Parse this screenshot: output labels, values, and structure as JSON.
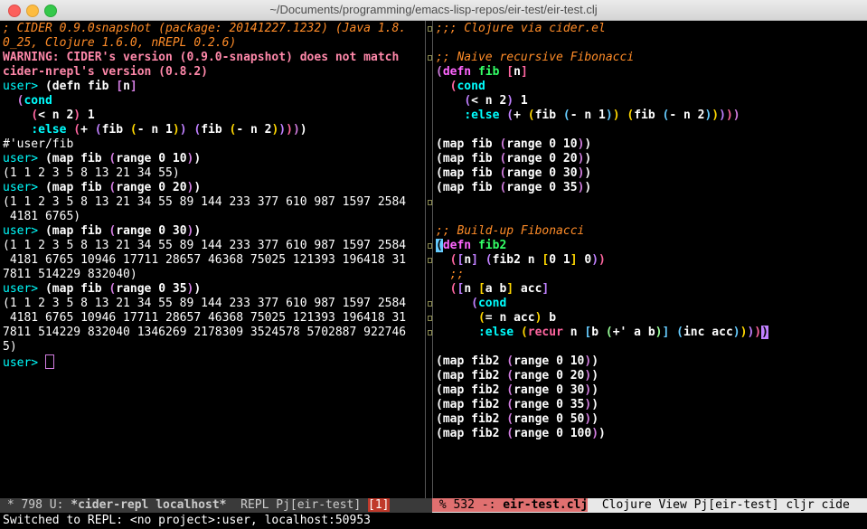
{
  "window": {
    "title": "~/Documents/programming/emacs-lisp-repos/eir-test/eir-test.clj"
  },
  "colors": {
    "comment": "#ff8c28",
    "warning": "#ff88aa",
    "prompt": "#00ffff",
    "paren1": "#ffffff",
    "paren2": "#d27de0",
    "paren3": "#ff66a0",
    "paren4": "#c080ff",
    "keyword": "#00ffff",
    "defn": "#ff66ff",
    "fnname": "#33ff66",
    "special": "#ff66a0",
    "number": "#ffffff",
    "cursor": "#d27de0"
  },
  "left_lines": [
    [
      {
        "t": "; CIDER 0.9.0snapshot (package: 20141227.1232) (Java 1.8.",
        "c": "comment"
      }
    ],
    [
      {
        "t": "0_25, Clojure 1.6.0, nREPL 0.2.6)",
        "c": "comment"
      }
    ],
    [
      {
        "t": "WARNING: CIDER's version (0.9.0-snapshot) does not match",
        "c": "warning"
      }
    ],
    [
      {
        "t": "cider-nrepl's version (0.8.2)",
        "c": "warning"
      }
    ],
    [
      {
        "t": "user> ",
        "c": "prompt"
      },
      {
        "t": "(",
        "c": "p1"
      },
      {
        "t": "defn fib ",
        "c": "code"
      },
      {
        "t": "[",
        "c": "p2"
      },
      {
        "t": "n",
        "c": "code"
      },
      {
        "t": "]",
        "c": "p2"
      }
    ],
    [
      {
        "t": "  ",
        "c": "code"
      },
      {
        "t": "(",
        "c": "p2"
      },
      {
        "t": "cond",
        "c": "kw2"
      }
    ],
    [
      {
        "t": "    ",
        "c": "code"
      },
      {
        "t": "(",
        "c": "p3"
      },
      {
        "t": "< n 2",
        "c": "code"
      },
      {
        "t": ")",
        "c": "p3"
      },
      {
        "t": " 1",
        "c": "code"
      }
    ],
    [
      {
        "t": "    ",
        "c": "code"
      },
      {
        "t": ":else",
        "c": "kw"
      },
      {
        "t": " ",
        "c": "code"
      },
      {
        "t": "(",
        "c": "p3"
      },
      {
        "t": "+ ",
        "c": "code"
      },
      {
        "t": "(",
        "c": "p4"
      },
      {
        "t": "fib ",
        "c": "code"
      },
      {
        "t": "(",
        "c": "p5"
      },
      {
        "t": "- n 1",
        "c": "code"
      },
      {
        "t": ")",
        "c": "p5"
      },
      {
        "t": ")",
        "c": "p4"
      },
      {
        "t": " ",
        "c": "code"
      },
      {
        "t": "(",
        "c": "p4"
      },
      {
        "t": "fib ",
        "c": "code"
      },
      {
        "t": "(",
        "c": "p5"
      },
      {
        "t": "- n 2",
        "c": "code"
      },
      {
        "t": ")",
        "c": "p5"
      },
      {
        "t": ")",
        "c": "p4"
      },
      {
        "t": ")",
        "c": "p3"
      },
      {
        "t": ")",
        "c": "p2"
      },
      {
        "t": ")",
        "c": "p1"
      }
    ],
    [
      {
        "t": "#'user/fib",
        "c": "out"
      }
    ],
    [
      {
        "t": "user> ",
        "c": "prompt"
      },
      {
        "t": "(map fib ",
        "c": "code"
      },
      {
        "t": "(",
        "c": "p2"
      },
      {
        "t": "range 0 10",
        "c": "code"
      },
      {
        "t": ")",
        "c": "p2"
      },
      {
        "t": ")",
        "c": "code"
      }
    ],
    [
      {
        "t": "(1 1 2 3 5 8 13 21 34 55)",
        "c": "out"
      }
    ],
    [
      {
        "t": "user> ",
        "c": "prompt"
      },
      {
        "t": "(map fib ",
        "c": "code"
      },
      {
        "t": "(",
        "c": "p2"
      },
      {
        "t": "range 0 20",
        "c": "code"
      },
      {
        "t": ")",
        "c": "p2"
      },
      {
        "t": ")",
        "c": "code"
      }
    ],
    [
      {
        "t": "(1 1 2 3 5 8 13 21 34 55 89 144 233 377 610 987 1597 2584",
        "c": "out"
      }
    ],
    [
      {
        "t": " 4181 6765)",
        "c": "out"
      }
    ],
    [
      {
        "t": "user> ",
        "c": "prompt"
      },
      {
        "t": "(map fib ",
        "c": "code"
      },
      {
        "t": "(",
        "c": "p2"
      },
      {
        "t": "range 0 30",
        "c": "code"
      },
      {
        "t": ")",
        "c": "p2"
      },
      {
        "t": ")",
        "c": "code"
      }
    ],
    [
      {
        "t": "(1 1 2 3 5 8 13 21 34 55 89 144 233 377 610 987 1597 2584",
        "c": "out"
      }
    ],
    [
      {
        "t": " 4181 6765 10946 17711 28657 46368 75025 121393 196418 31",
        "c": "out"
      }
    ],
    [
      {
        "t": "7811 514229 832040)",
        "c": "out"
      }
    ],
    [
      {
        "t": "user> ",
        "c": "prompt"
      },
      {
        "t": "(map fib ",
        "c": "code"
      },
      {
        "t": "(",
        "c": "p2"
      },
      {
        "t": "range 0 35",
        "c": "code"
      },
      {
        "t": ")",
        "c": "p2"
      },
      {
        "t": ")",
        "c": "code"
      }
    ],
    [
      {
        "t": "(1 1 2 3 5 8 13 21 34 55 89 144 233 377 610 987 1597 2584",
        "c": "out"
      }
    ],
    [
      {
        "t": " 4181 6765 10946 17711 28657 46368 75025 121393 196418 31",
        "c": "out"
      }
    ],
    [
      {
        "t": "7811 514229 832040 1346269 2178309 3524578 5702887 922746",
        "c": "out"
      }
    ],
    [
      {
        "t": "5)",
        "c": "out"
      }
    ],
    [
      {
        "t": "user> ",
        "c": "prompt"
      },
      {
        "t": "",
        "c": "cursor"
      }
    ]
  ],
  "right_lines": [
    [
      {
        "t": ";;; Clojure via cider.el",
        "c": "comment"
      }
    ],
    [
      {
        "t": "",
        "c": "out"
      }
    ],
    [
      {
        "t": ";; Naive recursive Fibonacci",
        "c": "comment"
      }
    ],
    [
      {
        "t": "(",
        "c": "p2"
      },
      {
        "t": "defn",
        "c": "defn"
      },
      {
        "t": " ",
        "c": "code"
      },
      {
        "t": "fib",
        "c": "fn"
      },
      {
        "t": " ",
        "c": "code"
      },
      {
        "t": "[",
        "c": "p3"
      },
      {
        "t": "n",
        "c": "code"
      },
      {
        "t": "]",
        "c": "p3"
      }
    ],
    [
      {
        "t": "  ",
        "c": "code"
      },
      {
        "t": "(",
        "c": "p3"
      },
      {
        "t": "cond",
        "c": "kw2"
      }
    ],
    [
      {
        "t": "    ",
        "c": "code"
      },
      {
        "t": "(",
        "c": "p4"
      },
      {
        "t": "< n 2",
        "c": "code"
      },
      {
        "t": ")",
        "c": "p4"
      },
      {
        "t": " 1",
        "c": "code"
      }
    ],
    [
      {
        "t": "    ",
        "c": "code"
      },
      {
        "t": ":else",
        "c": "kw"
      },
      {
        "t": " ",
        "c": "code"
      },
      {
        "t": "(",
        "c": "p4"
      },
      {
        "t": "+ ",
        "c": "code"
      },
      {
        "t": "(",
        "c": "p5"
      },
      {
        "t": "fib ",
        "c": "code"
      },
      {
        "t": "(",
        "c": "p6"
      },
      {
        "t": "- n 1",
        "c": "code"
      },
      {
        "t": ")",
        "c": "p6"
      },
      {
        "t": ")",
        "c": "p5"
      },
      {
        "t": " ",
        "c": "code"
      },
      {
        "t": "(",
        "c": "p5"
      },
      {
        "t": "fib ",
        "c": "code"
      },
      {
        "t": "(",
        "c": "p6"
      },
      {
        "t": "- n 2",
        "c": "code"
      },
      {
        "t": ")",
        "c": "p6"
      },
      {
        "t": ")",
        "c": "p5"
      },
      {
        "t": ")",
        "c": "p4"
      },
      {
        "t": ")",
        "c": "p3"
      },
      {
        "t": ")",
        "c": "p2"
      }
    ],
    [
      {
        "t": "",
        "c": "out"
      }
    ],
    [
      {
        "t": "(map fib ",
        "c": "code"
      },
      {
        "t": "(",
        "c": "p2"
      },
      {
        "t": "range 0 10",
        "c": "code"
      },
      {
        "t": ")",
        "c": "p2"
      },
      {
        "t": ")",
        "c": "code"
      }
    ],
    [
      {
        "t": "(map fib ",
        "c": "code"
      },
      {
        "t": "(",
        "c": "p2"
      },
      {
        "t": "range 0 20",
        "c": "code"
      },
      {
        "t": ")",
        "c": "p2"
      },
      {
        "t": ")",
        "c": "code"
      }
    ],
    [
      {
        "t": "(map fib ",
        "c": "code"
      },
      {
        "t": "(",
        "c": "p2"
      },
      {
        "t": "range 0 30",
        "c": "code"
      },
      {
        "t": ")",
        "c": "p2"
      },
      {
        "t": ")",
        "c": "code"
      }
    ],
    [
      {
        "t": "(map fib ",
        "c": "code"
      },
      {
        "t": "(",
        "c": "p2"
      },
      {
        "t": "range 0 35",
        "c": "code"
      },
      {
        "t": ")",
        "c": "p2"
      },
      {
        "t": ")",
        "c": "code"
      }
    ],
    [
      {
        "t": "",
        "c": "out"
      }
    ],
    [
      {
        "t": "",
        "c": "out"
      }
    ],
    [
      {
        "t": ";; Build-up Fibonacci",
        "c": "comment"
      }
    ],
    [
      {
        "t": "(",
        "c": "phl"
      },
      {
        "t": "defn",
        "c": "defn"
      },
      {
        "t": " ",
        "c": "code"
      },
      {
        "t": "fib2",
        "c": "fn"
      }
    ],
    [
      {
        "t": "  ",
        "c": "code"
      },
      {
        "t": "(",
        "c": "p3"
      },
      {
        "t": "[",
        "c": "p4"
      },
      {
        "t": "n",
        "c": "code"
      },
      {
        "t": "]",
        "c": "p4"
      },
      {
        "t": " ",
        "c": "code"
      },
      {
        "t": "(",
        "c": "p4"
      },
      {
        "t": "fib2 n ",
        "c": "code"
      },
      {
        "t": "[",
        "c": "p5"
      },
      {
        "t": "0 1",
        "c": "code"
      },
      {
        "t": "]",
        "c": "p5"
      },
      {
        "t": " 0",
        "c": "code"
      },
      {
        "t": ")",
        "c": "p4"
      },
      {
        "t": ")",
        "c": "p3"
      }
    ],
    [
      {
        "t": "  ",
        "c": "code"
      },
      {
        "t": ";;",
        "c": "comment"
      }
    ],
    [
      {
        "t": "  ",
        "c": "code"
      },
      {
        "t": "(",
        "c": "p3"
      },
      {
        "t": "[",
        "c": "p4"
      },
      {
        "t": "n ",
        "c": "code"
      },
      {
        "t": "[",
        "c": "p5"
      },
      {
        "t": "a b",
        "c": "code"
      },
      {
        "t": "]",
        "c": "p5"
      },
      {
        "t": " acc",
        "c": "code"
      },
      {
        "t": "]",
        "c": "p4"
      }
    ],
    [
      {
        "t": "     ",
        "c": "code"
      },
      {
        "t": "(",
        "c": "p4"
      },
      {
        "t": "cond",
        "c": "kw2"
      }
    ],
    [
      {
        "t": "      ",
        "c": "code"
      },
      {
        "t": "(",
        "c": "p5"
      },
      {
        "t": "= n acc",
        "c": "code"
      },
      {
        "t": ")",
        "c": "p5"
      },
      {
        "t": " b",
        "c": "code"
      }
    ],
    [
      {
        "t": "      ",
        "c": "code"
      },
      {
        "t": ":else",
        "c": "kw"
      },
      {
        "t": " ",
        "c": "code"
      },
      {
        "t": "(",
        "c": "p5"
      },
      {
        "t": "recur",
        "c": "special"
      },
      {
        "t": " n ",
        "c": "code"
      },
      {
        "t": "[",
        "c": "p6"
      },
      {
        "t": "b ",
        "c": "code"
      },
      {
        "t": "(",
        "c": "p7"
      },
      {
        "t": "+' a b",
        "c": "code"
      },
      {
        "t": ")",
        "c": "p7"
      },
      {
        "t": "]",
        "c": "p6"
      },
      {
        "t": " ",
        "c": "code"
      },
      {
        "t": "(",
        "c": "p6"
      },
      {
        "t": "inc acc",
        "c": "code"
      },
      {
        "t": ")",
        "c": "p6"
      },
      {
        "t": ")",
        "c": "p5"
      },
      {
        "t": ")",
        "c": "p4"
      },
      {
        "t": ")",
        "c": "p3"
      },
      {
        "t": ")",
        "c": "phl2"
      }
    ],
    [
      {
        "t": "",
        "c": "out"
      }
    ],
    [
      {
        "t": "(map fib2 ",
        "c": "code"
      },
      {
        "t": "(",
        "c": "p2"
      },
      {
        "t": "range 0 10",
        "c": "code"
      },
      {
        "t": ")",
        "c": "p2"
      },
      {
        "t": ")",
        "c": "code"
      }
    ],
    [
      {
        "t": "(map fib2 ",
        "c": "code"
      },
      {
        "t": "(",
        "c": "p2"
      },
      {
        "t": "range 0 20",
        "c": "code"
      },
      {
        "t": ")",
        "c": "p2"
      },
      {
        "t": ")",
        "c": "code"
      }
    ],
    [
      {
        "t": "(map fib2 ",
        "c": "code"
      },
      {
        "t": "(",
        "c": "p2"
      },
      {
        "t": "range 0 30",
        "c": "code"
      },
      {
        "t": ")",
        "c": "p2"
      },
      {
        "t": ")",
        "c": "code"
      }
    ],
    [
      {
        "t": "(map fib2 ",
        "c": "code"
      },
      {
        "t": "(",
        "c": "p2"
      },
      {
        "t": "range 0 35",
        "c": "code"
      },
      {
        "t": ")",
        "c": "p2"
      },
      {
        "t": ")",
        "c": "code"
      }
    ],
    [
      {
        "t": "(map fib2 ",
        "c": "code"
      },
      {
        "t": "(",
        "c": "p2"
      },
      {
        "t": "range 0 50",
        "c": "code"
      },
      {
        "t": ")",
        "c": "p2"
      },
      {
        "t": ")",
        "c": "code"
      }
    ],
    [
      {
        "t": "(map fib2 ",
        "c": "code"
      },
      {
        "t": "(",
        "c": "p2"
      },
      {
        "t": "range 0 100",
        "c": "code"
      },
      {
        "t": ")",
        "c": "p2"
      },
      {
        "t": ")",
        "c": "code"
      }
    ]
  ],
  "modeline_left": {
    "prefix": " * 798 U: ",
    "buffer": "*cider-repl localhost*",
    "mid": "  REPL Pj[eir-test] ",
    "badge": "[1]"
  },
  "modeline_right": {
    "prefix": " % 532 -: ",
    "buffer": "eir-test.clj",
    "mid": "  Clojure View Pj[eir-test] cljr cide"
  },
  "echo": "Switched to REPL: <no project>:user, localhost:50953"
}
